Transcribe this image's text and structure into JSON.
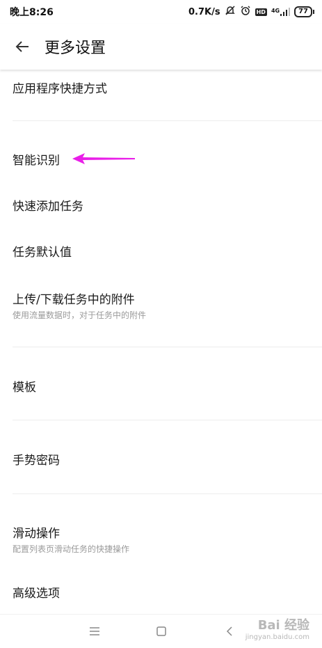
{
  "status_bar": {
    "time": "晚上8:26",
    "speed": "0.7K/s",
    "network": "4G",
    "hd": "HD",
    "battery": "77"
  },
  "app_bar": {
    "title": "更多设置"
  },
  "items": [
    {
      "title": "应用程序快捷方式",
      "subtitle": ""
    },
    {
      "title": "智能识别",
      "subtitle": ""
    },
    {
      "title": "快速添加任务",
      "subtitle": ""
    },
    {
      "title": "任务默认值",
      "subtitle": ""
    },
    {
      "title": "上传/下载任务中的附件",
      "subtitle": "使用流量数据时，对于任务中的附件"
    },
    {
      "title": "模板",
      "subtitle": ""
    },
    {
      "title": "手势密码",
      "subtitle": ""
    },
    {
      "title": "滑动操作",
      "subtitle": "配置列表页滑动任务的快捷操作"
    },
    {
      "title": "高级选项",
      "subtitle": ""
    }
  ],
  "annotation": {
    "color": "#e91ee8"
  },
  "watermark": {
    "main": "Bai 经验",
    "sub": "jingyan.baidu.com"
  }
}
